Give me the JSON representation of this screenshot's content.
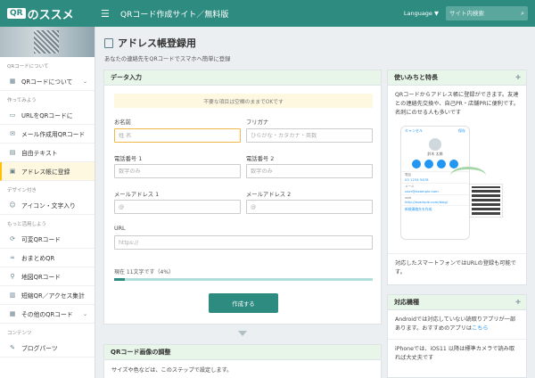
{
  "header": {
    "logo_box": "QR",
    "logo_text": "のススメ",
    "menu_icon": "hamburger-icon",
    "site_title": "QRコード作成サイト／無料版",
    "language": "Language ▼",
    "search_placeholder": "サイト内検索",
    "search_icon": "search-icon"
  },
  "sidebar": {
    "sections": [
      {
        "title": "QRコードについて",
        "items": [
          {
            "label": "QRコードについて",
            "icon": "qr-icon",
            "chevron": "⌄"
          }
        ]
      },
      {
        "title": "作ってみよう",
        "items": [
          {
            "label": "URLをQRコードに",
            "icon": "link-icon"
          },
          {
            "label": "メール作成用QRコード",
            "icon": "mail-icon"
          },
          {
            "label": "自由テキスト",
            "icon": "doc-icon"
          },
          {
            "label": "アドレス帳に登録",
            "icon": "addressbook-icon"
          }
        ]
      },
      {
        "title": "デザイン付き",
        "items": [
          {
            "label": "アイコン・文字入り",
            "icon": "smile-icon"
          }
        ]
      },
      {
        "title": "もっと活用しよう",
        "items": [
          {
            "label": "可変QRコード",
            "icon": "refresh-icon"
          },
          {
            "label": "おまとめQR",
            "icon": "link-icon"
          },
          {
            "label": "地図QRコード",
            "icon": "pin-icon"
          },
          {
            "label": "短縮QR／アクセス集計",
            "icon": "chart-icon"
          },
          {
            "label": "その他のQRコード",
            "icon": "grid-icon",
            "chevron": "⌄"
          }
        ]
      },
      {
        "title": "コンテンツ",
        "items": [
          {
            "label": "ブログパーツ",
            "icon": "blog-icon"
          }
        ]
      }
    ]
  },
  "main": {
    "title": "アドレス帳登録用",
    "subtitle": "あなたの連絡先をQRコードでスマホへ簡単に登録",
    "form_card": {
      "header": "データ入力",
      "notice": "不要な項目は空欄のままでOKです",
      "fields": {
        "name": {
          "label": "お名前",
          "placeholder": "姓 名"
        },
        "kana": {
          "label": "フリガナ",
          "placeholder": "ひらがな・カタカナ・英数"
        },
        "phone1": {
          "label": "電話番号 1",
          "placeholder": "数字のみ"
        },
        "phone2": {
          "label": "電話番号 2",
          "placeholder": "数字のみ"
        },
        "mail1": {
          "label": "メールアドレス 1",
          "placeholder": "@"
        },
        "mail2": {
          "label": "メールアドレス 2",
          "placeholder": "@"
        },
        "url": {
          "label": "URL",
          "placeholder": "https://"
        }
      },
      "status": "現在 11文字です（4%）",
      "progress_percent": 4,
      "submit": "作成する"
    },
    "adjust_card": {
      "header": "QRコード画像の調整",
      "text": "サイズや色などは、このステップで設定します。"
    },
    "usage_card": {
      "header": "使いみちと特長",
      "text": "QRコードからアドレス帳に登録ができます。友達との連絡先交換や、自己PR・店舗PRに便利です。名刺にのせる人も多いです",
      "caption": "対応したスマートフォンではURLの登録も可能です。",
      "phone": {
        "cancel": "キャンセル",
        "save": "保存",
        "name": "鈴木 太郎",
        "tel_label": "電話",
        "tel": "03 1234 5678",
        "mail_label": "メール",
        "mail": "user@example.com",
        "web_label": "web",
        "web": "http://example.com/blog/",
        "new_contact": "新規連絡先を作成"
      }
    },
    "compat_card": {
      "header": "対応機種",
      "text1": "Androidでは対応していない読取りアプリが一部あります。おすすめのアプリは",
      "text1_link": "こちら",
      "text2": "iPhoneでは、iOS11 以降は標準カメラで読み取れば大丈夫です"
    }
  }
}
